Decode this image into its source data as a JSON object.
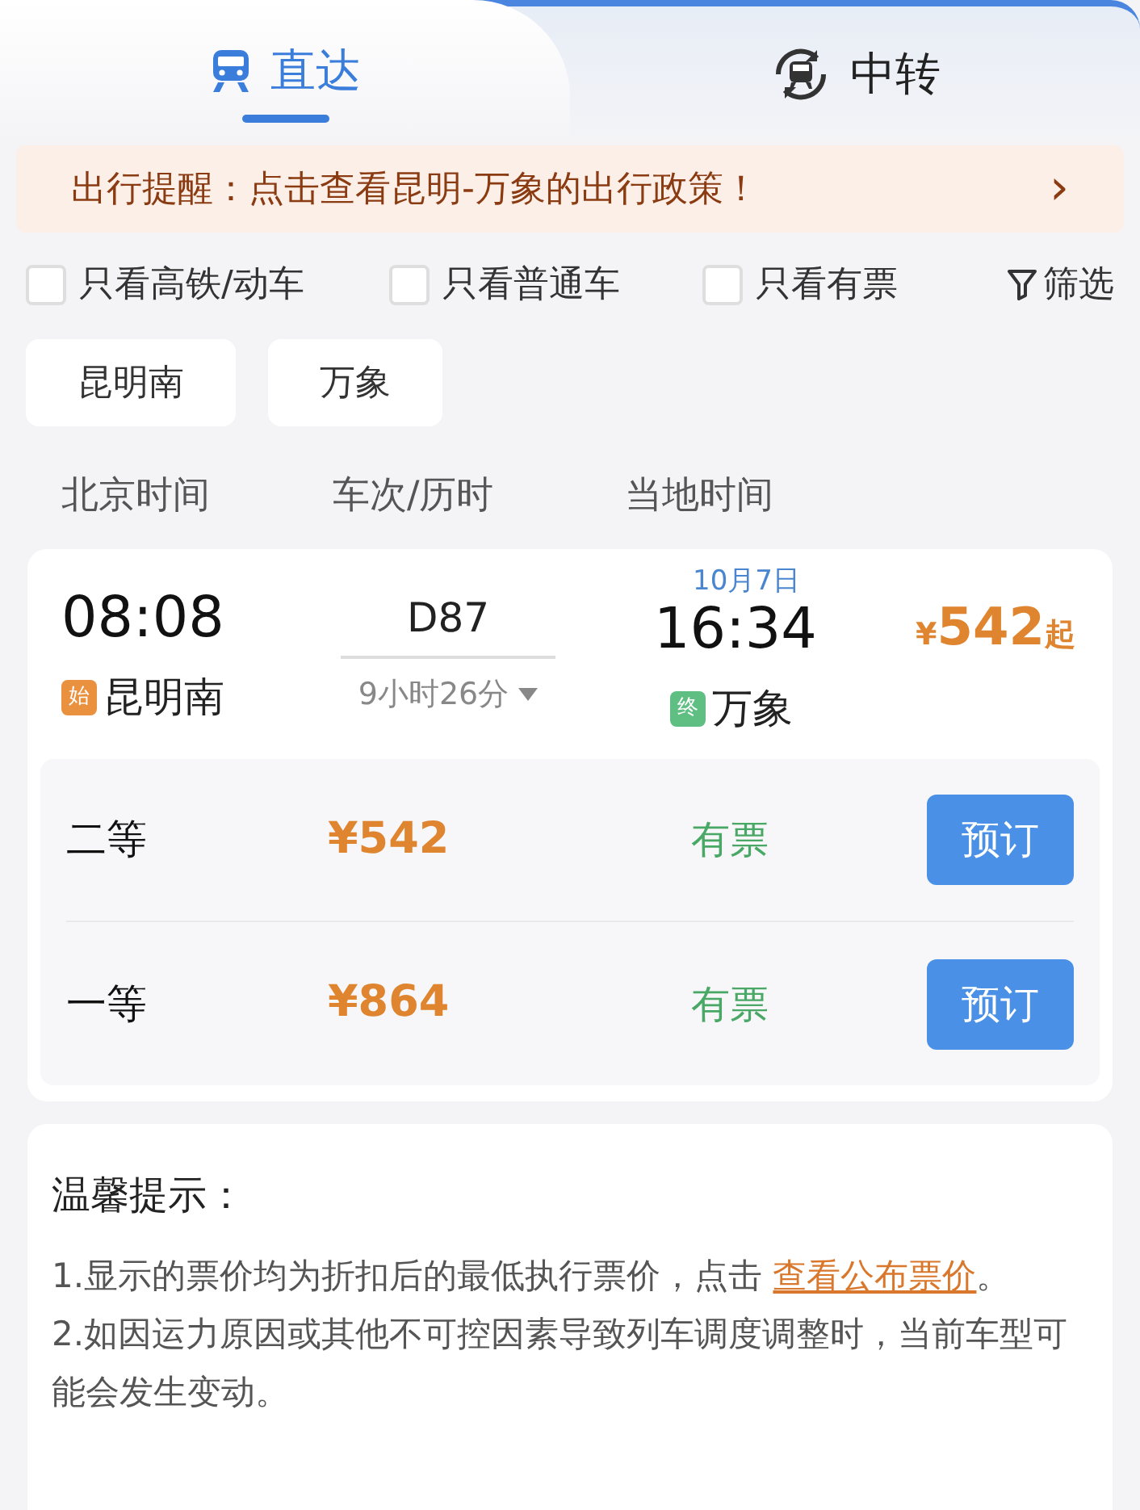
{
  "tabs": [
    {
      "label": "直达",
      "kind": "direct",
      "selected": true
    },
    {
      "label": "中转",
      "kind": "transfer",
      "selected": false
    }
  ],
  "notice": {
    "text": "出行提醒：点击查看昆明-万象的出行政策！",
    "arrow": "›"
  },
  "filters": [
    {
      "label": "只看高铁/动车",
      "checked": false
    },
    {
      "label": "只看普通车",
      "checked": false
    },
    {
      "label": "只看有票",
      "checked": false
    }
  ],
  "filter_button": "筛选",
  "stations": [
    "昆明南",
    "万象"
  ],
  "columns": [
    "北京时间",
    "车次/历时",
    "当地时间"
  ],
  "train": {
    "depart_time": "08:08",
    "depart_badge": "始",
    "depart_station": "昆明南",
    "number": "D87",
    "duration": "9小时26分",
    "arrive_date": "10月7日",
    "arrive_time": "16:34",
    "arrive_badge": "终",
    "arrive_station": "万象",
    "price_symbol": "¥",
    "price": "542",
    "price_suffix": "起",
    "seats": [
      {
        "class": "二等",
        "price": "¥542",
        "availability": "有票",
        "button": "预订"
      },
      {
        "class": "一等",
        "price": "¥864",
        "availability": "有票",
        "button": "预订"
      }
    ]
  },
  "tips": {
    "title": "温馨提示：",
    "notes": [
      {
        "before": "1.显示的票价均为折扣后的最低执行票价，点击 ",
        "link": "查看公布票价",
        "after": "。"
      },
      {
        "before": "2.如因运力原因或其他不可控因素导致列车调度调整时，当前车型可能会发生变动。"
      }
    ]
  }
}
